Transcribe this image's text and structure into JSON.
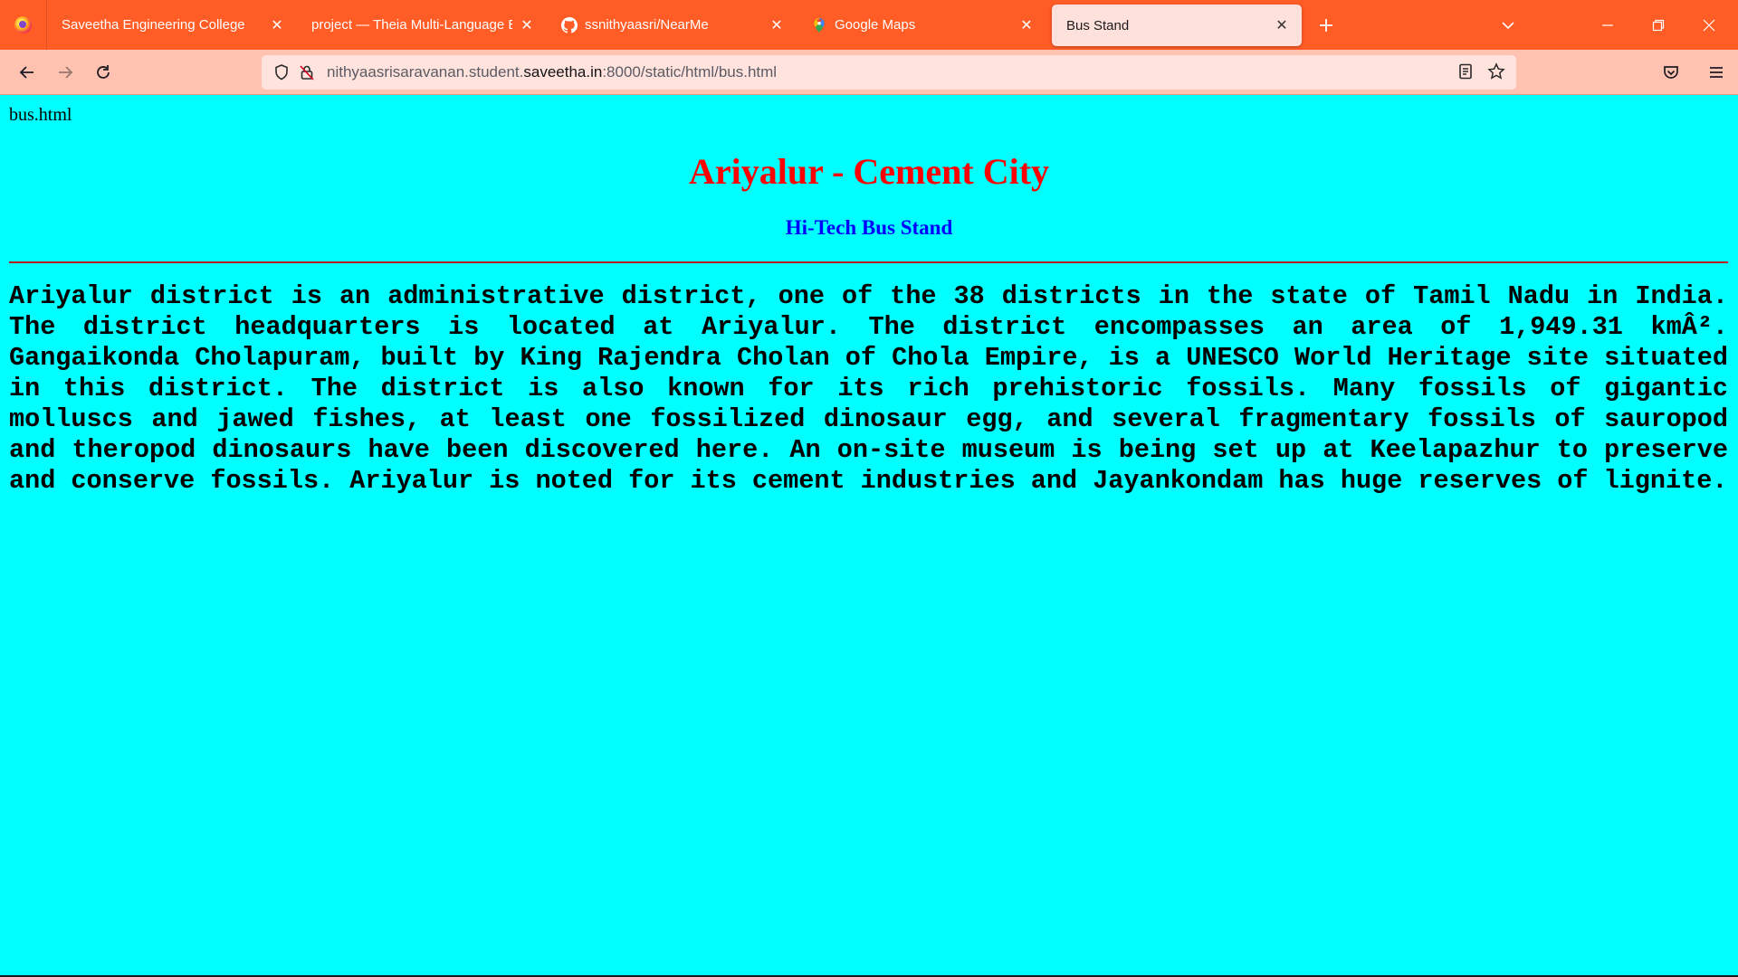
{
  "browser": {
    "tabs": [
      {
        "title": "Saveetha Engineering College",
        "active": false,
        "icon": "none"
      },
      {
        "title": "project — Theia Multi-Language Ex",
        "active": false,
        "icon": "none"
      },
      {
        "title": "ssnithyaasri/NearMe",
        "active": false,
        "icon": "github-icon"
      },
      {
        "title": "Google Maps",
        "active": false,
        "icon": "google-maps-icon"
      },
      {
        "title": "Bus Stand",
        "active": true,
        "icon": "none"
      }
    ],
    "url": {
      "prefix": "nithyaasrisaravanan.student.",
      "domain": "saveetha.in",
      "suffix": ":8000/static/html/bus.html"
    },
    "colors": {
      "tabstrip": "#ff5c26",
      "toolbar": "#ffc2b0",
      "active_tab": "#ffe1dc"
    }
  },
  "page": {
    "label": "bus.html",
    "heading": "Ariyalur - Cement City",
    "subheading": "Hi-Tech Bus Stand",
    "paragraph": "Ariyalur district is an administrative district, one of the 38 districts in the state of Tamil Nadu in India. The district headquarters is located at Ariyalur. The district encompasses an area of 1,949.31 kmÂ². Gangaikonda Cholapuram, built by King Rajendra Cholan of Chola Empire, is a UNESCO World Heritage site situated in this district. The district is also known for its rich prehistoric fossils. Many fossils of gigantic molluscs and jawed fishes, at least one fossilized dinosaur egg, and several fragmentary fossils of sauropod and theropod dinosaurs have been discovered here. An on-site museum is being set up at Keelapazhur to preserve and conserve fossils. Ariyalur is noted for its cement industries and Jayankondam has huge reserves of lignite.",
    "colors": {
      "background": "#00ffff",
      "heading": "#ff0000",
      "subheading": "#0000ff",
      "rule": "#b22222"
    }
  }
}
